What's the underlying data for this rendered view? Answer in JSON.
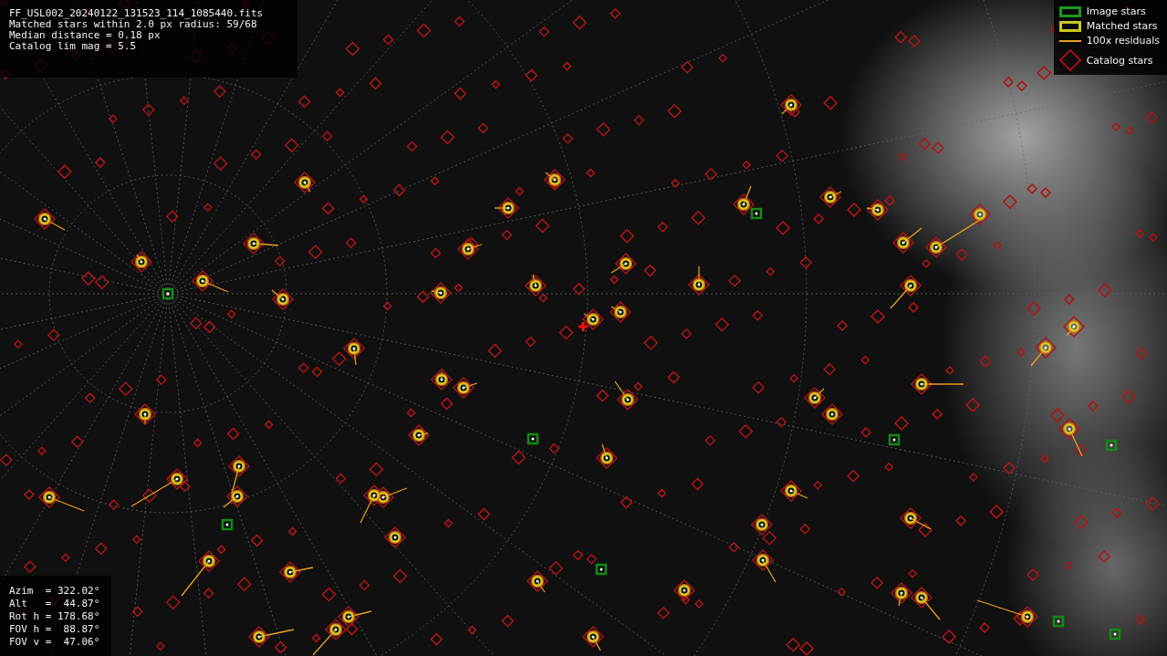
{
  "file_info": {
    "lines": [
      "FF_USL002_20240122_131523_114_1085440.fits",
      "Matched stars within 2.0 px radius: 59/68",
      "Median distance = 0.18 px",
      "Catalog lim mag = 5.5"
    ]
  },
  "legend": [
    {
      "kind": "image",
      "label": "Image stars"
    },
    {
      "kind": "matched",
      "label": "Matched stars"
    },
    {
      "kind": "residual",
      "label": "100x residuals"
    },
    {
      "kind": "catalog",
      "label": "Catalog stars"
    }
  ],
  "pointing": {
    "lines": [
      "Azim  = 322.02°",
      "Alt   =  44.87°",
      "Rot h = 178.68°",
      "FOV h =  88.87°",
      "FOV v =  47.06°"
    ]
  }
}
